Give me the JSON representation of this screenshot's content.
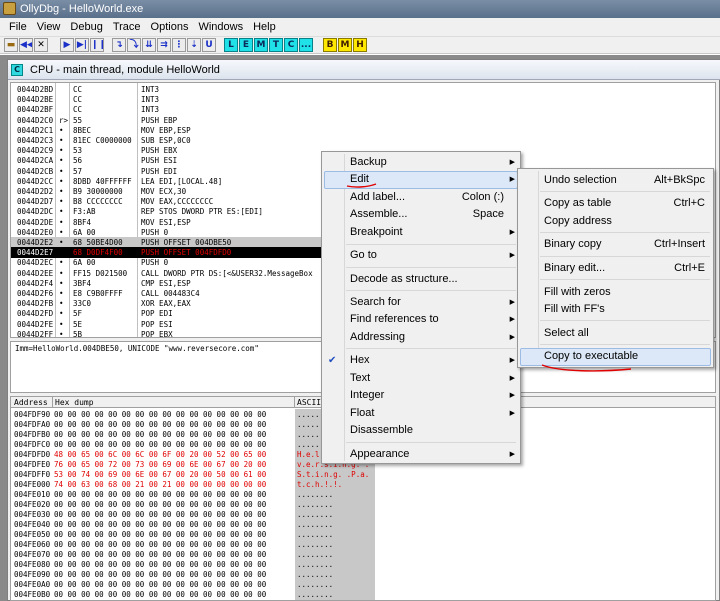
{
  "window": {
    "title": "OllyDbg - HelloWorld.exe"
  },
  "menubar": [
    "File",
    "View",
    "Debug",
    "Trace",
    "Options",
    "Windows",
    "Help"
  ],
  "toolbar": {
    "letters": [
      "L",
      "E",
      "M",
      "T",
      "C",
      "...",
      "B",
      "M",
      "H"
    ]
  },
  "cpu_window": {
    "title": "CPU - main thread, module HelloWorld"
  },
  "disasm": {
    "rows": [
      {
        "addr": "0044D2BD",
        "mark": "",
        "hex": "CC",
        "cmd": "INT3"
      },
      {
        "addr": "0044D2BE",
        "mark": "",
        "hex": "CC",
        "cmd": "INT3"
      },
      {
        "addr": "0044D2BF",
        "mark": "",
        "hex": "CC",
        "cmd": "INT3"
      },
      {
        "addr": "0044D2C0",
        "mark": "r>",
        "hex": "55",
        "cmd": "PUSH EBP"
      },
      {
        "addr": "0044D2C1",
        "mark": "•",
        "hex": "8BEC",
        "cmd": "MOV EBP,ESP"
      },
      {
        "addr": "0044D2C3",
        "mark": "•",
        "hex": "81EC C0000000",
        "cmd": "SUB ESP,0C0"
      },
      {
        "addr": "0044D2C9",
        "mark": "•",
        "hex": "53",
        "cmd": "PUSH EBX"
      },
      {
        "addr": "0044D2CA",
        "mark": "•",
        "hex": "56",
        "cmd": "PUSH ESI"
      },
      {
        "addr": "0044D2CB",
        "mark": "•",
        "hex": "57",
        "cmd": "PUSH EDI"
      },
      {
        "addr": "0044D2CC",
        "mark": "•",
        "hex": "8DBD 40FFFFFF",
        "cmd": "LEA EDI,[LOCAL.48]"
      },
      {
        "addr": "0044D2D2",
        "mark": "•",
        "hex": "B9 30000000",
        "cmd": "MOV ECX,30"
      },
      {
        "addr": "0044D2D7",
        "mark": "•",
        "hex": "B8 CCCCCCCC",
        "cmd": "MOV EAX,CCCCCCCC"
      },
      {
        "addr": "0044D2DC",
        "mark": "•",
        "hex": "F3:AB",
        "cmd": "REP STOS DWORD PTR ES:[EDI]"
      },
      {
        "addr": "0044D2DE",
        "mark": "•",
        "hex": "8BF4",
        "cmd": "MOV ESI,ESP"
      },
      {
        "addr": "0044D2E0",
        "mark": "•",
        "hex": "6A 00",
        "cmd": "PUSH 0"
      },
      {
        "addr": "0044D2E2",
        "mark": "•",
        "hex": "68 50BE4D00",
        "cmd": "PUSH OFFSET 004DBE50"
      },
      {
        "addr": "0044D2E7",
        "mark": "•",
        "hex": "68 D0DF4F00",
        "cmd": "PUSH OFFSET 004FDFD0"
      },
      {
        "addr": "0044D2EC",
        "mark": "•",
        "hex": "6A 00",
        "cmd": "PUSH 0"
      },
      {
        "addr": "0044D2EE",
        "mark": "•",
        "hex": "FF15 D021500",
        "cmd": "CALL DWORD PTR DS:[<&USER32.MessageBox"
      },
      {
        "addr": "0044D2F4",
        "mark": "•",
        "hex": "3BF4",
        "cmd": "CMP ESI,ESP"
      },
      {
        "addr": "0044D2F6",
        "mark": "•",
        "hex": "E8 C9B0FFFF",
        "cmd": "CALL 004483C4"
      },
      {
        "addr": "0044D2FB",
        "mark": "•",
        "hex": "33C0",
        "cmd": "XOR EAX,EAX"
      },
      {
        "addr": "0044D2FD",
        "mark": "•",
        "hex": "5F",
        "cmd": "POP EDI"
      },
      {
        "addr": "0044D2FE",
        "mark": "•",
        "hex": "5E",
        "cmd": "POP ESI"
      },
      {
        "addr": "0044D2FF",
        "mark": "•",
        "hex": "5B",
        "cmd": "POP EBX"
      }
    ]
  },
  "info": {
    "text": "Imm=HelloWorld.004DBE50, UNICODE \"www.reversecore.com\""
  },
  "dump": {
    "headers": {
      "address": "Address",
      "hex": "Hex dump",
      "ascii": "ASCII"
    },
    "rows": [
      {
        "addr": "004FDF90",
        "hex": "00 00 00 00 00 00 00 00 00 00 00 00 00 00 00 00",
        "ascii": "........",
        "red": false
      },
      {
        "addr": "004FDFA0",
        "hex": "00 00 00 00 00 00 00 00 00 00 00 00 00 00 00 00",
        "ascii": "........",
        "red": false
      },
      {
        "addr": "004FDFB0",
        "hex": "00 00 00 00 00 00 00 00 00 00 00 00 00 00 00 00",
        "ascii": "........",
        "red": false
      },
      {
        "addr": "004FDFC0",
        "hex": "00 00 00 00 00 00 00 00 00 00 00 00 00 00 00 00",
        "ascii": "........",
        "red": false
      },
      {
        "addr": "004FDFD0",
        "hex": "48 00 65 00 6C 00 6C 00 6F 00 20 00 52 00 65 00",
        "ascii": "H.e.l.l.o. .R.e.",
        "red": true
      },
      {
        "addr": "004FDFE0",
        "hex": "76 00 65 00 72 00 73 00 69 00 6E 00 67 00 20 00",
        "ascii": "v.e.r.s.i.n.g. .",
        "red": true
      },
      {
        "addr": "004FDFF0",
        "hex": "53 00 74 00 69 00 6E 00 67 00 20 00 50 00 61 00",
        "ascii": "S.t.i.n.g. .P.a.",
        "red": true
      },
      {
        "addr": "004FE000",
        "hex": "74 00 63 00 68 00 21 00 21 00 00 00 00 00 00 00",
        "ascii": "t.c.h.!.!.",
        "red": true
      },
      {
        "addr": "004FE010",
        "hex": "00 00 00 00 00 00 00 00 00 00 00 00 00 00 00 00",
        "ascii": "........",
        "red": false
      },
      {
        "addr": "004FE020",
        "hex": "00 00 00 00 00 00 00 00 00 00 00 00 00 00 00 00",
        "ascii": "........",
        "red": false
      },
      {
        "addr": "004FE030",
        "hex": "00 00 00 00 00 00 00 00 00 00 00 00 00 00 00 00",
        "ascii": "........",
        "red": false
      },
      {
        "addr": "004FE040",
        "hex": "00 00 00 00 00 00 00 00 00 00 00 00 00 00 00 00",
        "ascii": "........",
        "red": false
      },
      {
        "addr": "004FE050",
        "hex": "00 00 00 00 00 00 00 00 00 00 00 00 00 00 00 00",
        "ascii": "........",
        "red": false
      },
      {
        "addr": "004FE060",
        "hex": "00 00 00 00 00 00 00 00 00 00 00 00 00 00 00 00",
        "ascii": "........",
        "red": false
      },
      {
        "addr": "004FE070",
        "hex": "00 00 00 00 00 00 00 00 00 00 00 00 00 00 00 00",
        "ascii": "........",
        "red": false
      },
      {
        "addr": "004FE080",
        "hex": "00 00 00 00 00 00 00 00 00 00 00 00 00 00 00 00",
        "ascii": "........",
        "red": false
      },
      {
        "addr": "004FE090",
        "hex": "00 00 00 00 00 00 00 00 00 00 00 00 00 00 00 00",
        "ascii": "........",
        "red": false
      },
      {
        "addr": "004FE0A0",
        "hex": "00 00 00 00 00 00 00 00 00 00 00 00 00 00 00 00",
        "ascii": "........",
        "red": false
      },
      {
        "addr": "004FE0B0",
        "hex": "00 00 00 00 00 00 00 00 00 00 00 00 00 00 00 00",
        "ascii": "........",
        "red": false
      }
    ]
  },
  "context_menu": {
    "items": [
      {
        "label": "Backup",
        "shortcut": "",
        "submenu": true,
        "checked": false
      },
      {
        "label": "Edit",
        "shortcut": "",
        "submenu": true,
        "checked": false
      },
      {
        "label": "Add label...",
        "shortcut": "Colon (:)",
        "submenu": false,
        "checked": false
      },
      {
        "label": "Assemble...",
        "shortcut": "Space",
        "submenu": false,
        "checked": false
      },
      {
        "label": "Breakpoint",
        "shortcut": "",
        "submenu": true,
        "checked": false
      },
      {
        "label": "Go to",
        "shortcut": "",
        "submenu": true,
        "checked": false
      },
      {
        "label": "Decode as structure...",
        "shortcut": "",
        "submenu": false,
        "checked": false
      },
      {
        "label": "Search for",
        "shortcut": "",
        "submenu": true,
        "checked": false
      },
      {
        "label": "Find references to",
        "shortcut": "",
        "submenu": true,
        "checked": false
      },
      {
        "label": "Addressing",
        "shortcut": "",
        "submenu": true,
        "checked": false
      },
      {
        "label": "Hex",
        "shortcut": "",
        "submenu": true,
        "checked": true
      },
      {
        "label": "Text",
        "shortcut": "",
        "submenu": true,
        "checked": false
      },
      {
        "label": "Integer",
        "shortcut": "",
        "submenu": true,
        "checked": false
      },
      {
        "label": "Float",
        "shortcut": "",
        "submenu": true,
        "checked": false
      },
      {
        "label": "Disassemble",
        "shortcut": "",
        "submenu": false,
        "checked": false
      },
      {
        "label": "Appearance",
        "shortcut": "",
        "submenu": true,
        "checked": false
      }
    ]
  },
  "edit_submenu": {
    "items": [
      {
        "label": "Undo selection",
        "shortcut": "Alt+BkSpc"
      },
      {
        "label": "Copy as table",
        "shortcut": "Ctrl+C"
      },
      {
        "label": "Copy address",
        "shortcut": ""
      },
      {
        "label": "Binary copy",
        "shortcut": "Ctrl+Insert"
      },
      {
        "label": "Binary edit...",
        "shortcut": "Ctrl+E"
      },
      {
        "label": "Fill with zeros",
        "shortcut": ""
      },
      {
        "label": "Fill with FF's",
        "shortcut": ""
      },
      {
        "label": "Select all",
        "shortcut": ""
      },
      {
        "label": "Copy to executable",
        "shortcut": ""
      }
    ]
  },
  "colors": {
    "annotation_red": "#e00000",
    "highlight": "#dce8f8",
    "check": "#2050c0"
  }
}
